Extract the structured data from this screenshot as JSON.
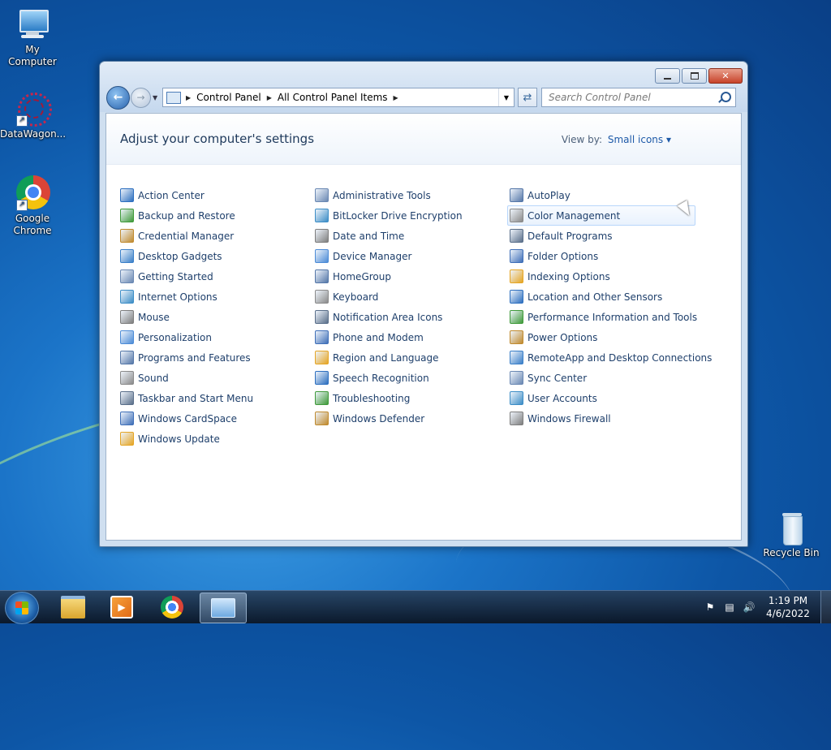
{
  "desktop": {
    "icons": [
      {
        "label": "My Computer",
        "icon": "computer-icon"
      },
      {
        "label": "DataWagon...",
        "icon": "datawagon-icon"
      },
      {
        "label": "Google Chrome",
        "icon": "chrome-icon"
      },
      {
        "label": "Recycle Bin",
        "icon": "recycle-bin-icon"
      }
    ]
  },
  "window": {
    "breadcrumb": [
      "Control Panel",
      "All Control Panel Items"
    ],
    "search_placeholder": "Search Control Panel",
    "heading": "Adjust your computer's settings",
    "view_by_label": "View by:",
    "view_by_value": "Small icons",
    "hovered_item": "Color Management",
    "columns": [
      [
        "Action Center",
        "Backup and Restore",
        "Credential Manager",
        "Desktop Gadgets",
        "Getting Started",
        "Internet Options",
        "Mouse",
        "Personalization",
        "Programs and Features",
        "Sound",
        "Taskbar and Start Menu",
        "Windows CardSpace",
        "Windows Update"
      ],
      [
        "Administrative Tools",
        "BitLocker Drive Encryption",
        "Date and Time",
        "Device Manager",
        "HomeGroup",
        "Keyboard",
        "Notification Area Icons",
        "Phone and Modem",
        "Region and Language",
        "Speech Recognition",
        "Troubleshooting",
        "Windows Defender"
      ],
      [
        "AutoPlay",
        "Color Management",
        "Default Programs",
        "Folder Options",
        "Indexing Options",
        "Location and Other Sensors",
        "Performance Information and Tools",
        "Power Options",
        "RemoteApp and Desktop Connections",
        "Sync Center",
        "User Accounts",
        "Windows Firewall"
      ]
    ]
  },
  "taskbar": {
    "apps": [
      "windows-explorer-icon",
      "media-player-icon",
      "chrome-icon",
      "control-panel-icon"
    ],
    "active_app": "control-panel-icon",
    "time": "1:19 PM",
    "date": "4/6/2022"
  },
  "colors": {
    "link": "#1e3f6b",
    "title": "#1e395b",
    "accent": "#1e5aa8"
  }
}
